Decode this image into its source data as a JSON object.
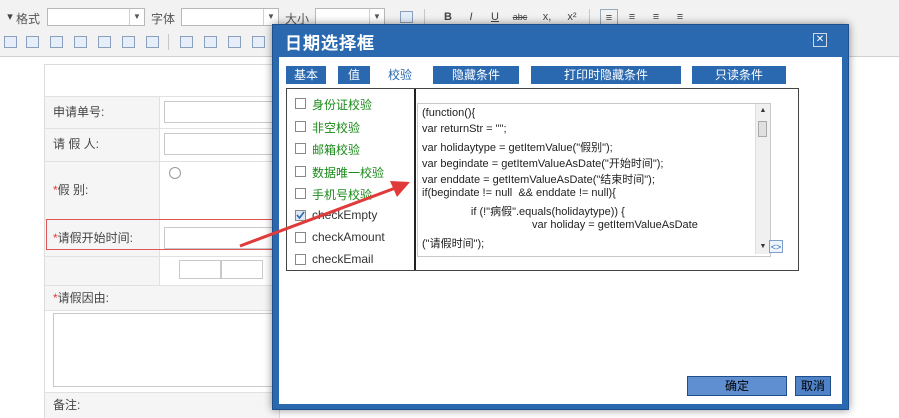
{
  "toolbar": {
    "format_label": "格式",
    "font_label": "字体",
    "size_label": "大小",
    "bold": "B",
    "italic": "I",
    "underline": "U",
    "strike": "abc",
    "subscript": "x,",
    "superscript": "x²"
  },
  "form": {
    "rows": [
      {
        "label": "申请单号:",
        "required": false
      },
      {
        "label": "请 假 人:",
        "required": false
      },
      {
        "label": "假    别:",
        "required": true
      },
      {
        "label": "请假开始时间:",
        "required": true
      },
      {
        "label": "请假因由:",
        "required": true
      },
      {
        "label": "备注:",
        "required": false
      }
    ],
    "required_mark": "*"
  },
  "dialog": {
    "title": "日期选择框",
    "close_icon": "close-icon",
    "tabs": [
      {
        "label": "基本",
        "active": false
      },
      {
        "label": "值",
        "active": false
      },
      {
        "label": "校验",
        "active": true
      },
      {
        "label": "隐藏条件",
        "active": false
      },
      {
        "label": "打印时隐藏条件",
        "active": false
      },
      {
        "label": "只读条件",
        "active": false
      }
    ],
    "checks": [
      {
        "label": "身份证校验",
        "checked": false
      },
      {
        "label": "非空校验",
        "checked": false
      },
      {
        "label": "邮箱校验",
        "checked": false
      },
      {
        "label": "数据唯一校验",
        "checked": false
      },
      {
        "label": "手机号校验",
        "checked": false
      },
      {
        "label": "checkEmpty",
        "checked": true
      },
      {
        "label": "checkAmount",
        "checked": false
      },
      {
        "label": "checkEmail",
        "checked": false
      }
    ],
    "code_lines": [
      "(function(){",
      "var returnStr = \"\";",
      "var holidaytype = getItemValue(\"假别\");",
      "var begindate = getItemValueAsDate(\"开始时间\");",
      "var enddate = getItemValueAsDate(\"结束时间\");",
      "if(begindate != null  && enddate != null){",
      "                if (!\"病假\".equals(holidaytype)) {",
      "                                    var holiday = getItemValueAsDate",
      "(\"请假时间\");"
    ],
    "ok_label": "确定",
    "cancel_label": "取消"
  },
  "colors": {
    "dialog_blue": "#2a68b0",
    "button_blue": "#5f8fd0",
    "annotation_red": "#e03a3a",
    "check_label_green": "#1a8a1a"
  }
}
